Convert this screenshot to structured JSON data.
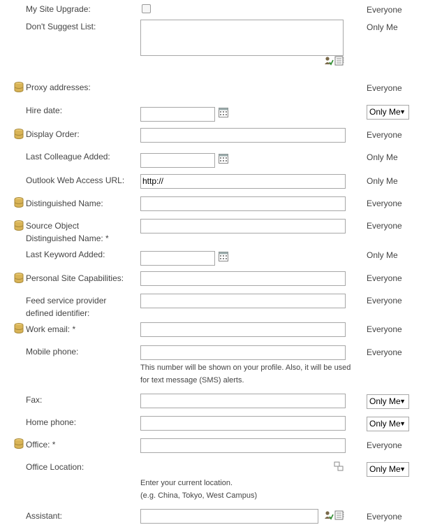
{
  "fields": {
    "my_site_upgrade": {
      "label": "My Site Upgrade:",
      "privacy": "Everyone"
    },
    "dont_suggest_list": {
      "label": "Don't Suggest List:",
      "privacy": "Only Me"
    },
    "proxy_addresses": {
      "label": "Proxy addresses:",
      "privacy": "Everyone"
    },
    "hire_date": {
      "label": "Hire date:",
      "privacy": "Only Me"
    },
    "display_order": {
      "label": "Display Order:",
      "privacy": "Everyone"
    },
    "last_colleague_added": {
      "label": "Last Colleague Added:",
      "privacy": "Only Me"
    },
    "outlook_web_access_url": {
      "label": "Outlook Web Access URL:",
      "value": "http://",
      "privacy": "Only Me"
    },
    "distinguished_name": {
      "label": "Distinguished Name:",
      "privacy": "Everyone"
    },
    "source_object_dn": {
      "label": "Source Object Distinguished Name: *",
      "privacy": "Everyone"
    },
    "last_keyword_added": {
      "label": "Last Keyword Added:",
      "privacy": "Only Me"
    },
    "personal_site_capabilities": {
      "label": "Personal Site Capabilities:",
      "privacy": "Everyone"
    },
    "feed_service_provider": {
      "label": "Feed service provider defined identifier:",
      "privacy": "Everyone"
    },
    "work_email": {
      "label": "Work email: *",
      "privacy": "Everyone"
    },
    "mobile_phone": {
      "label": "Mobile phone:",
      "privacy": "Everyone",
      "help": "This number will be shown on your profile. Also, it will be used for text message (SMS) alerts."
    },
    "fax": {
      "label": "Fax:",
      "privacy": "Only Me"
    },
    "home_phone": {
      "label": "Home phone:",
      "privacy": "Only Me"
    },
    "office": {
      "label": "Office: *",
      "privacy": "Everyone"
    },
    "office_location": {
      "label": "Office Location:",
      "privacy": "Only Me",
      "help_line1": "Enter your current location.",
      "help_line2": "(e.g. China, Tokyo, West Campus)"
    },
    "assistant": {
      "label": "Assistant:",
      "privacy": "Everyone"
    }
  },
  "icons": {
    "synced_property": "database-icon",
    "calendar": "calendar-icon",
    "check_names": "check-names-icon",
    "browse": "address-book-icon",
    "location": "location-icon"
  },
  "colors": {
    "border": "#a7a7a7",
    "text": "#444444"
  }
}
